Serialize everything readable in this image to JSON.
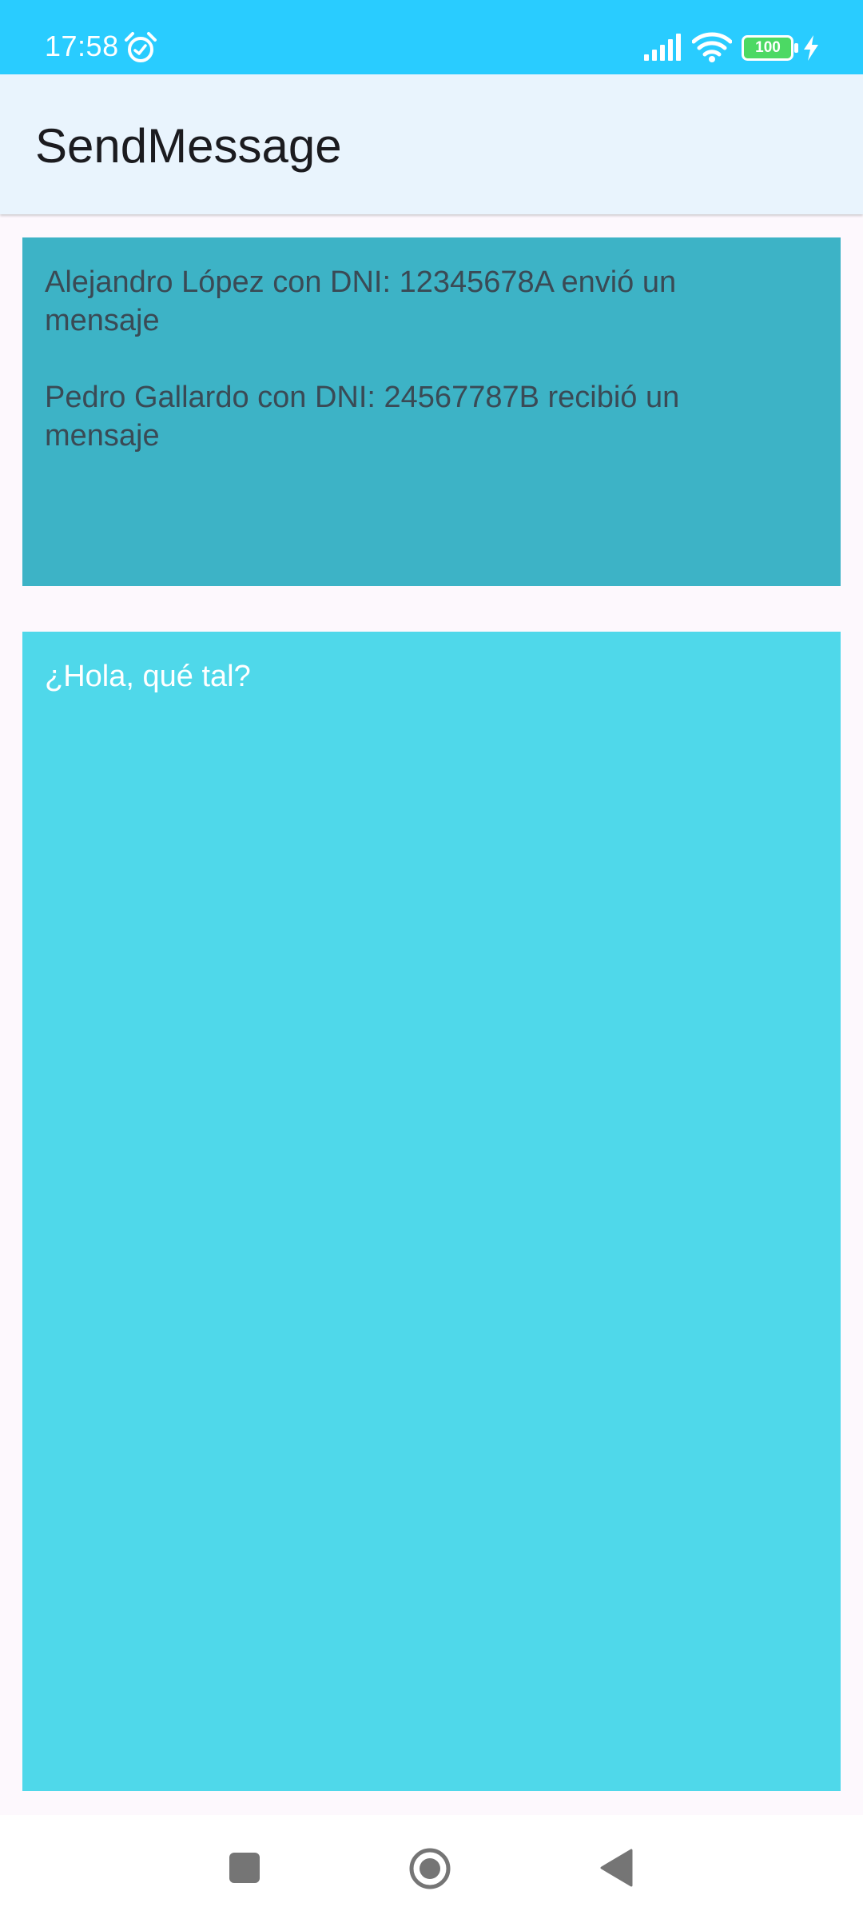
{
  "status_bar": {
    "time": "17:58",
    "battery_level": "100",
    "icons": [
      "alarm-icon",
      "signal-icon",
      "wifi-icon",
      "battery-icon",
      "charging-icon"
    ],
    "background_color": "#29ccff"
  },
  "app_bar": {
    "title": "SendMessage",
    "background_color": "#e9f4fd"
  },
  "info_panel": {
    "sender_line": "Alejandro López con DNI: 12345678A envió un mensaje",
    "receiver_line": "Pedro Gallardo con DNI: 24567787B recibió un mensaje",
    "background_color": "#3db3c6",
    "text_color": "#3a4a55"
  },
  "message_area": {
    "message": "¿Hola, qué tal?",
    "background_color": "#4fd8ea",
    "text_color": "#ffffff"
  },
  "nav_bar": {
    "icons": [
      "recent-apps-icon",
      "home-icon",
      "back-icon"
    ],
    "icon_color": "#757575"
  }
}
